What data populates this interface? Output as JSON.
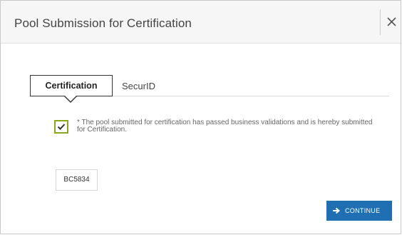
{
  "dialog": {
    "title": "Pool Submission for Certification",
    "close_icon": "close-icon"
  },
  "tabs": [
    {
      "label": "Certification",
      "active": true
    },
    {
      "label": "SecurID",
      "active": false
    }
  ],
  "certification": {
    "checkbox_checked": true,
    "statement": "* The pool submitted for certification has passed business validations and is hereby submitted for Certification."
  },
  "pool": {
    "id": "BC5834"
  },
  "actions": {
    "continue_label": "CONTINUE",
    "continue_icon": "arrow-right-icon"
  },
  "colors": {
    "accent": "#1f6fb2",
    "checkbox_border": "#8aa619",
    "header_bg": "#f6f6f6"
  }
}
